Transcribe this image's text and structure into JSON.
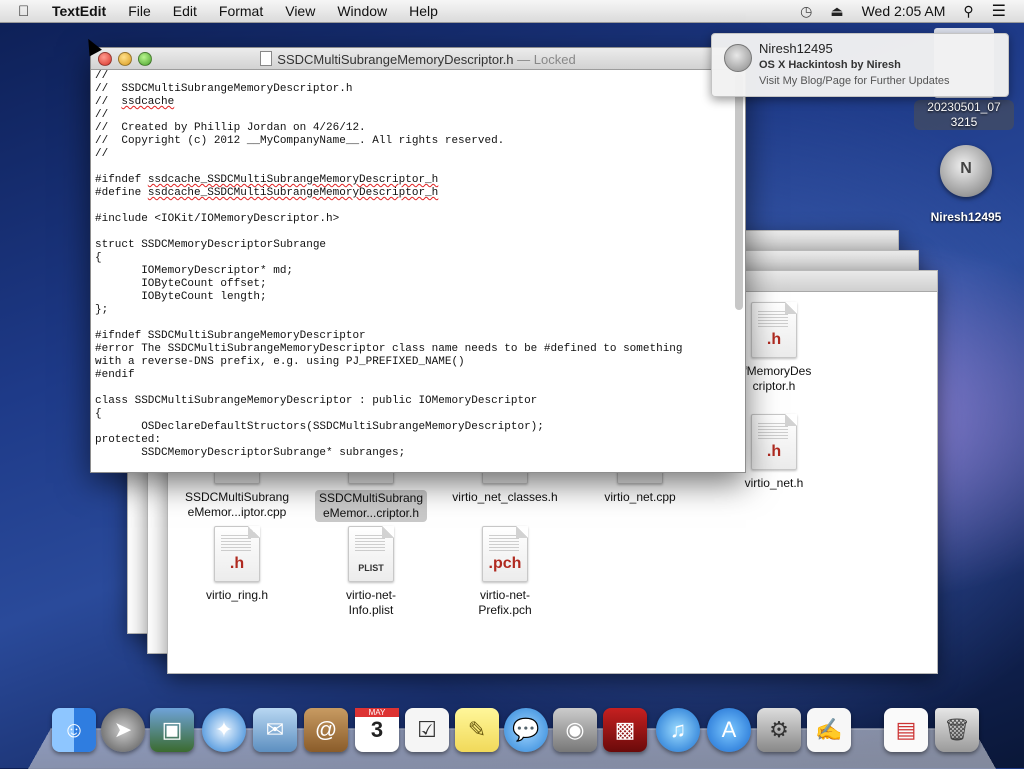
{
  "menubar": {
    "apple_icon": "apple-logo",
    "app_name": "TextEdit",
    "menus": [
      "File",
      "Edit",
      "Format",
      "View",
      "Window",
      "Help"
    ],
    "clock": "Wed 2:05 AM",
    "status_icons": [
      "time-machine-icon",
      "eject-icon",
      "spotlight-icon",
      "notification-center-icon"
    ]
  },
  "textedit": {
    "title": "SSDCMultiSubrangeMemoryDescriptor.h",
    "locked": "— Locked",
    "code_lines": [
      "//",
      "//  SSDCMultiSubrangeMemoryDescriptor.h",
      "//  ssdcache",
      "//",
      "//  Created by Phillip Jordan on 4/26/12.",
      "//  Copyright (c) 2012 __MyCompanyName__. All rights reserved.",
      "//",
      "",
      "#ifndef ssdcache_SSDCMultiSubrangeMemoryDescriptor_h",
      "#define ssdcache_SSDCMultiSubrangeMemoryDescriptor_h",
      "",
      "#include <IOKit/IOMemoryDescriptor.h>",
      "",
      "struct SSDCMemoryDescriptorSubrange",
      "{",
      "       IOMemoryDescriptor* md;",
      "       IOByteCount offset;",
      "       IOByteCount length;",
      "};",
      "",
      "#ifndef SSDCMultiSubrangeMemoryDescriptor",
      "#error The SSDCMultiSubrangeMemoryDescriptor class name needs to be #defined to something",
      "with a reverse-DNS prefix, e.g. using PJ_PREFIXED_NAME()",
      "#endif",
      "",
      "class SSDCMultiSubrangeMemoryDescriptor : public IOMemoryDescriptor",
      "{",
      "       OSDeclareDefaultStructors(SSDCMultiSubrangeMemoryDescriptor);",
      "protected:",
      "       SSDCMemoryDescriptorSubrange* subranges;"
    ]
  },
  "notification": {
    "title": "Niresh12495",
    "subtitle": "OS X Hackintosh by Niresh",
    "body": "Visit My Blog/Page for Further Updates"
  },
  "desktop": {
    "screenshot_label_1": "20230501_07",
    "screenshot_label_2": "3215",
    "disk_label": "Niresh12495",
    "disk_letter": "N"
  },
  "finder": {
    "files": [
      {
        "name1": "SSDCMultiSubrang",
        "name2": "eMemor...iptor.cpp",
        "ext": ""
      },
      {
        "name1": "SSDCMultiSubrang",
        "name2": "eMemor...criptor.h",
        "ext": ""
      },
      {
        "name1": "virtio_net_classes.h",
        "name2": "",
        "ext": ""
      },
      {
        "name1": "virtio_net.cpp",
        "name2": "",
        "ext": ""
      },
      {
        "name1": "virtio_net.h",
        "name2": "",
        "ext": ".h"
      },
      {
        "name1": "ufMemoryDes",
        "name2": "criptor.h",
        "ext": ".h"
      },
      {
        "name1": "virtio_ring.h",
        "name2": "",
        "ext": ".h"
      },
      {
        "name1": "virtio-net-",
        "name2": "Info.plist",
        "ext": "PLIST"
      },
      {
        "name1": "virtio-net-",
        "name2": "Prefix.pch",
        "ext": ".pch"
      }
    ]
  },
  "dock": {
    "apps": [
      "finder-icon",
      "launchpad-icon",
      "photo-browser-icon",
      "safari-icon",
      "mail-icon",
      "contacts-icon",
      "calendar-icon",
      "reminders-icon",
      "notes-icon",
      "messages-icon",
      "facetime-icon",
      "photo-booth-icon",
      "itunes-icon",
      "app-store-icon",
      "system-preferences-icon",
      "textedit-icon",
      "document-icon",
      "trash-icon"
    ],
    "calendar_day": "3",
    "calendar_month": "MAY"
  }
}
